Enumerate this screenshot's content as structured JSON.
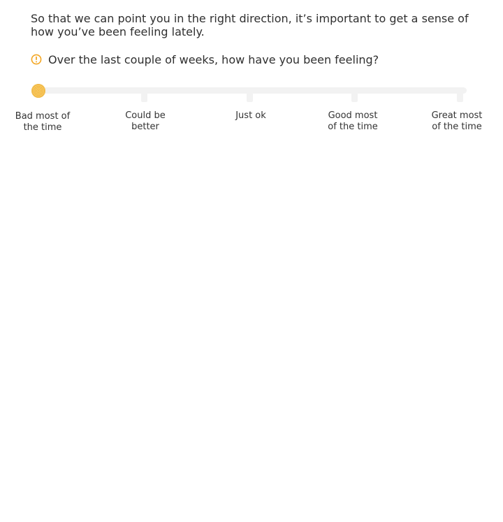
{
  "intro_text": "So that we can point you in the right direction, it’s important to get a sense of how you’ve been feeling lately.",
  "question": {
    "icon": "info-icon",
    "text": "Over the last couple of weeks, how have you been feeling?"
  },
  "slider": {
    "selected_index": 0,
    "accent_color": "#f3b33a",
    "track_color": "#f2f2f2",
    "options": [
      "Bad most of\nthe time",
      "Could be\nbetter",
      "Just ok",
      "Good most\nof the time",
      "Great most\nof the time"
    ]
  }
}
